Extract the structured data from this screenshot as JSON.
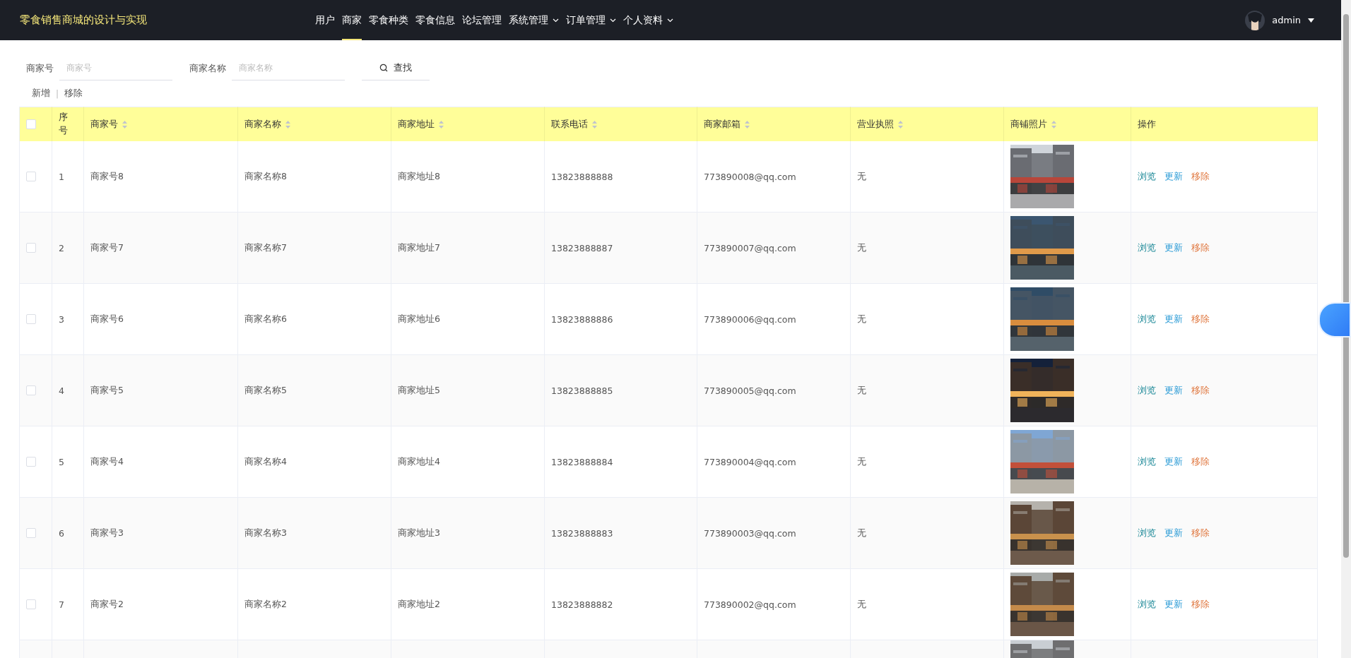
{
  "header": {
    "title": "零食销售商城的设计与实现",
    "nav": [
      {
        "label": "用户",
        "selected": false,
        "dropdown": false
      },
      {
        "label": "商家",
        "selected": true,
        "dropdown": false
      },
      {
        "label": "零食种类",
        "selected": false,
        "dropdown": false
      },
      {
        "label": "零食信息",
        "selected": false,
        "dropdown": false
      },
      {
        "label": "论坛管理",
        "selected": false,
        "dropdown": false
      },
      {
        "label": "系统管理",
        "selected": false,
        "dropdown": true
      },
      {
        "label": "订单管理",
        "selected": false,
        "dropdown": true
      },
      {
        "label": "个人资料",
        "selected": false,
        "dropdown": true
      }
    ],
    "user": {
      "name": "admin"
    }
  },
  "search": {
    "fields": [
      {
        "label": "商家号",
        "placeholder": "商家号"
      },
      {
        "label": "商家名称",
        "placeholder": "商家名称"
      }
    ],
    "button": "查找"
  },
  "actions": {
    "items": [
      "新增",
      "移除"
    ],
    "separator": "|"
  },
  "table": {
    "select_all": {
      "checked": false
    },
    "columns": [
      {
        "label": "序号",
        "sortable": false
      },
      {
        "label": "商家号",
        "sortable": true
      },
      {
        "label": "商家名称",
        "sortable": true
      },
      {
        "label": "商家地址",
        "sortable": true
      },
      {
        "label": "联系电话",
        "sortable": true
      },
      {
        "label": "商家邮箱",
        "sortable": true
      },
      {
        "label": "营业执照",
        "sortable": true
      },
      {
        "label": "商铺照片",
        "sortable": true
      },
      {
        "label": "操作",
        "sortable": false
      }
    ],
    "rows": [
      {
        "checked": false,
        "cells": [
          "1",
          "商家号8",
          "商家名称8",
          "商家地址8",
          "13823888888",
          "773890008@qq.com",
          "无"
        ],
        "photo": {
          "kind": "picture"
        },
        "ops": [
          "浏览",
          "更新",
          "移除"
        ]
      },
      {
        "checked": false,
        "cells": [
          "2",
          "商家号7",
          "商家名称7",
          "商家地址7",
          "13823888887",
          "773890007@qq.com",
          "无"
        ],
        "photo": {
          "kind": "picture"
        },
        "ops": [
          "浏览",
          "更新",
          "移除"
        ]
      },
      {
        "checked": false,
        "cells": [
          "3",
          "商家号6",
          "商家名称6",
          "商家地址6",
          "13823888886",
          "773890006@qq.com",
          "无"
        ],
        "photo": {
          "kind": "picture"
        },
        "ops": [
          "浏览",
          "更新",
          "移除"
        ]
      },
      {
        "checked": false,
        "cells": [
          "4",
          "商家号5",
          "商家名称5",
          "商家地址5",
          "13823888885",
          "773890005@qq.com",
          "无"
        ],
        "photo": {
          "kind": "picture"
        },
        "ops": [
          "浏览",
          "更新",
          "移除"
        ]
      },
      {
        "checked": false,
        "cells": [
          "5",
          "商家号4",
          "商家名称4",
          "商家地址4",
          "13823888884",
          "773890004@qq.com",
          "无"
        ],
        "photo": {
          "kind": "picture"
        },
        "ops": [
          "浏览",
          "更新",
          "移除"
        ]
      },
      {
        "checked": false,
        "cells": [
          "6",
          "商家号3",
          "商家名称3",
          "商家地址3",
          "13823888883",
          "773890003@qq.com",
          "无"
        ],
        "photo": {
          "kind": "picture"
        },
        "ops": [
          "浏览",
          "更新",
          "移除"
        ]
      },
      {
        "checked": false,
        "cells": [
          "7",
          "商家号2",
          "商家名称2",
          "商家地址2",
          "13823888882",
          "773890002@qq.com",
          "无"
        ],
        "photo": {
          "kind": "picture"
        },
        "ops": [
          "浏览",
          "更新",
          "移除"
        ]
      }
    ],
    "cut_row": {
      "photo": {
        "kind": "picture"
      }
    }
  }
}
